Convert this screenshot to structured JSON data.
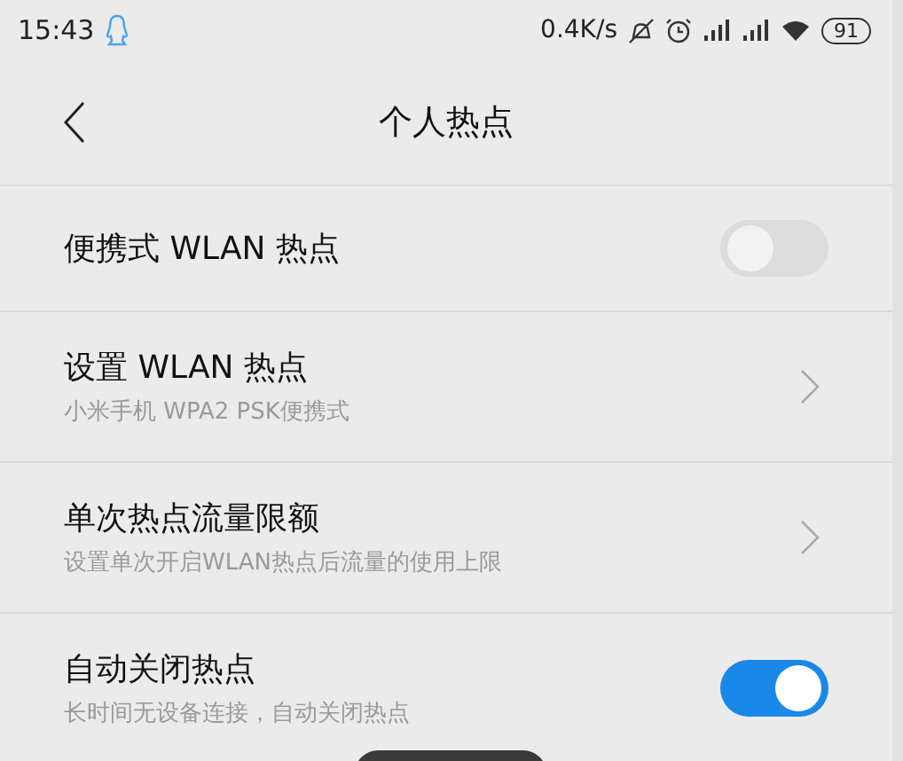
{
  "status_bar": {
    "time": "15:43",
    "speed": "0.4K/s",
    "battery": "91"
  },
  "header": {
    "title": "个人热点"
  },
  "rows": [
    {
      "kind": "switch",
      "title": "便携式 WLAN 热点",
      "on": false
    },
    {
      "kind": "link",
      "title": "设置 WLAN 热点",
      "subtitle": "小米手机 WPA2 PSK便携式"
    },
    {
      "kind": "link",
      "title": "单次热点流量限额",
      "subtitle": "设置单次开启WLAN热点后流量的使用上限"
    },
    {
      "kind": "switch",
      "title": "自动关闭热点",
      "subtitle": "长时间无设备连接，自动关闭热点",
      "on": true
    }
  ]
}
